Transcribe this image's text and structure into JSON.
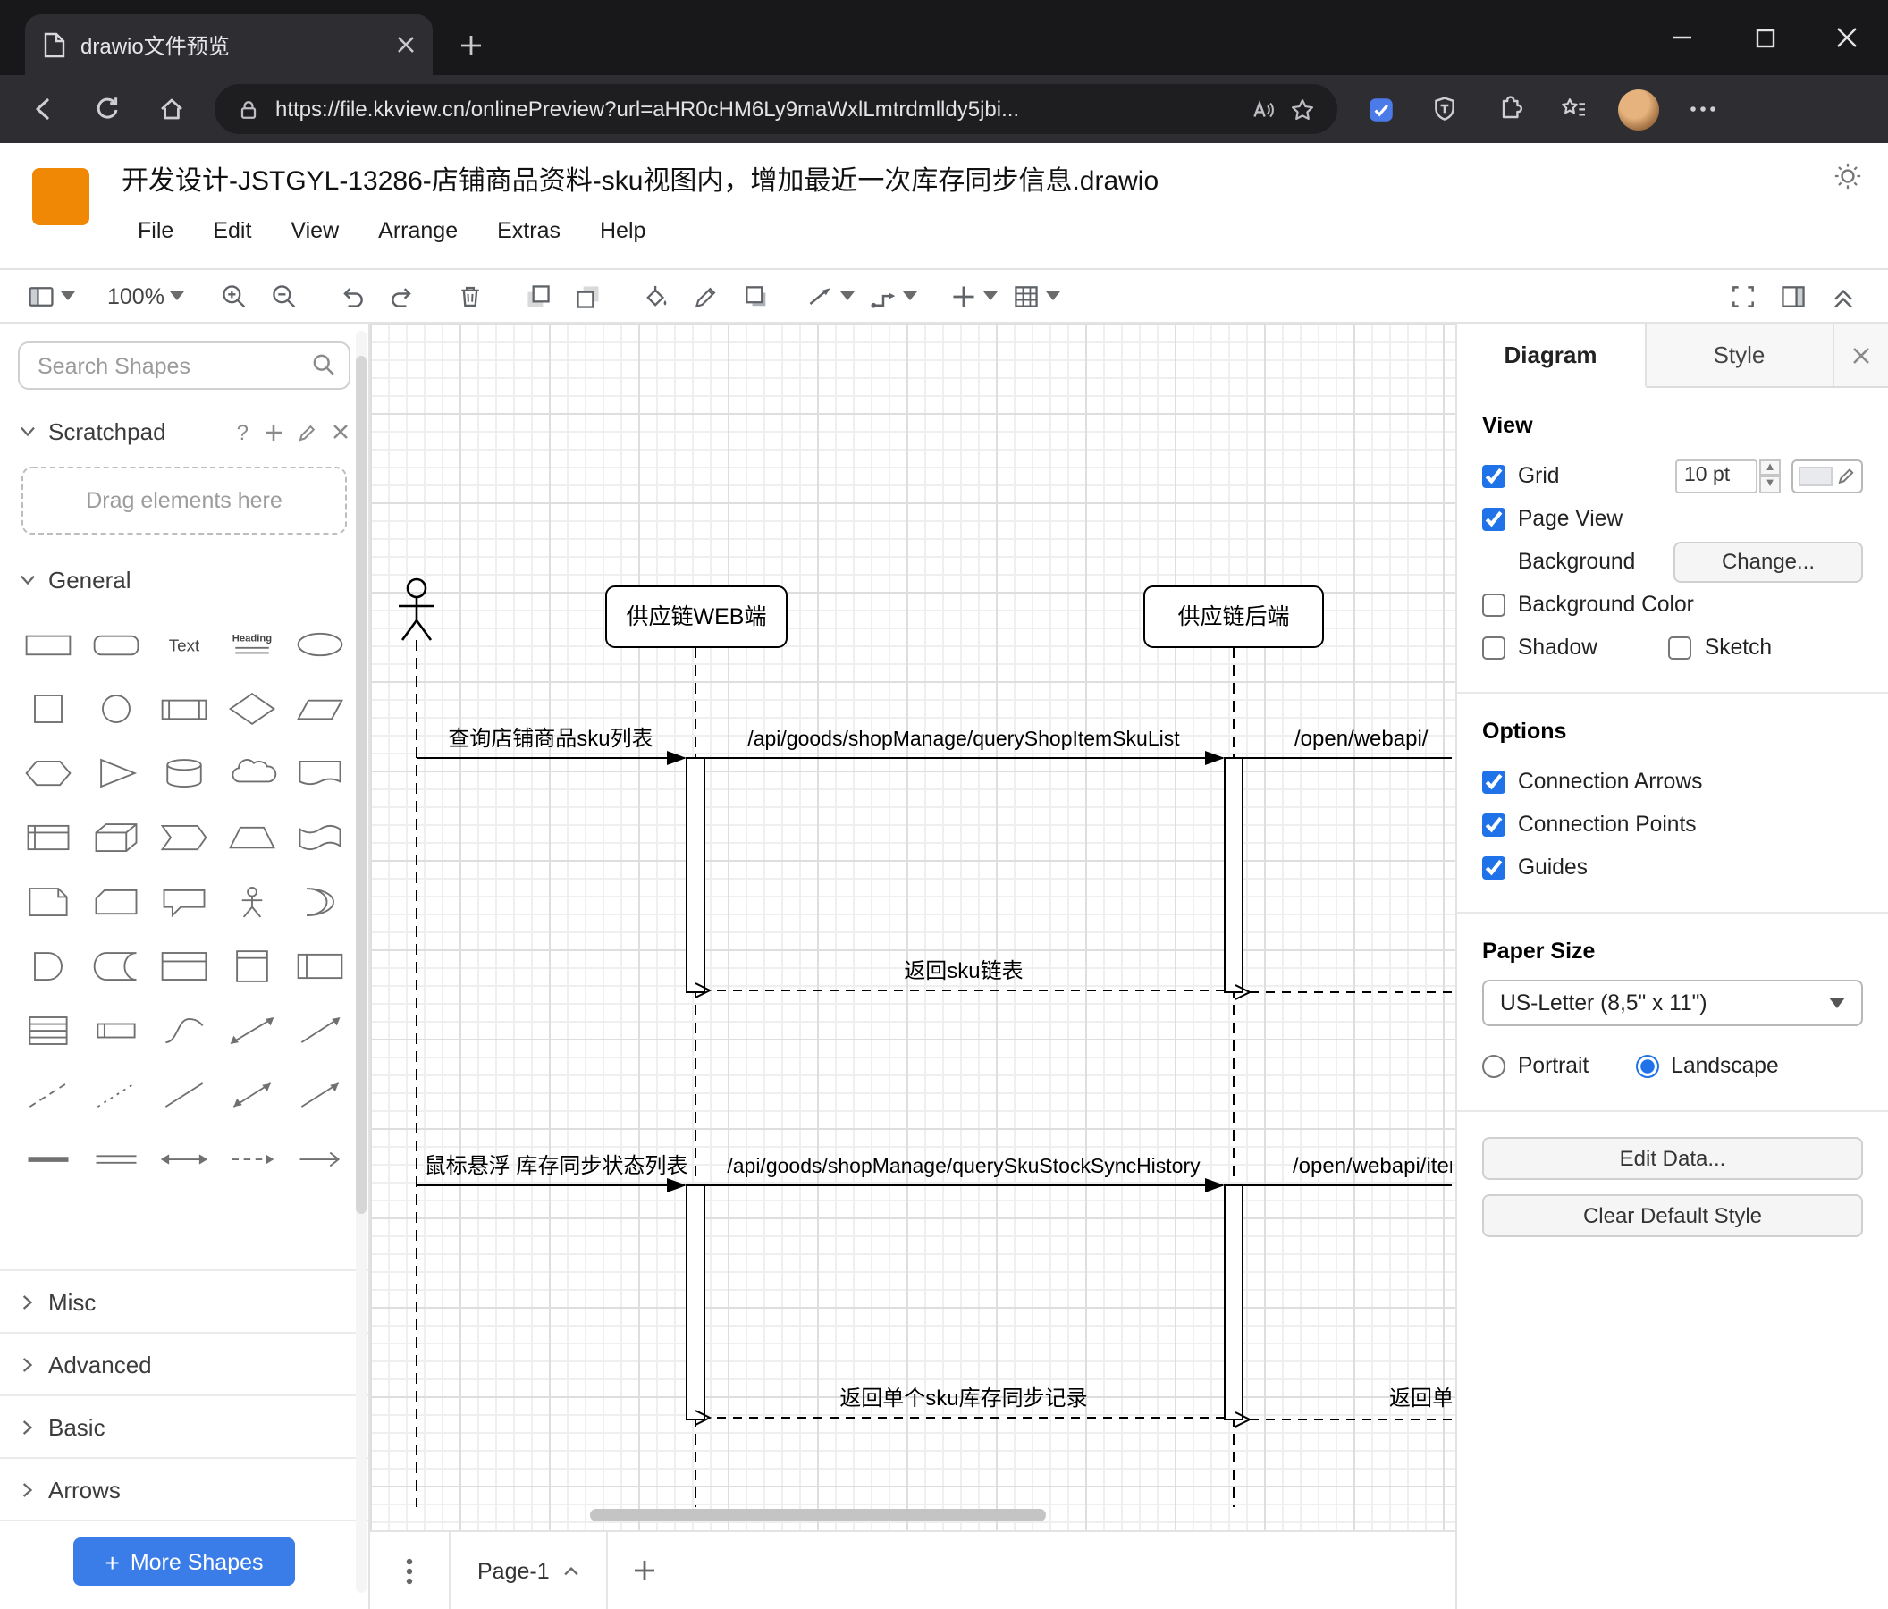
{
  "browser": {
    "tab_title": "drawio文件预览",
    "url": "https://file.kkview.cn/onlinePreview?url=aHR0cHM6Ly9maWxlLmtrdmlldy5jbi..."
  },
  "app": {
    "title": "开发设计-JSTGYL-13286-店铺商品资料-sku视图内，增加最近一次库存同步信息.drawio",
    "menus": [
      "File",
      "Edit",
      "View",
      "Arrange",
      "Extras",
      "Help"
    ],
    "zoom": "100%"
  },
  "sidebar": {
    "search_placeholder": "Search Shapes",
    "scratchpad_title": "Scratchpad",
    "help_glyph": "?",
    "drop_hint": "Drag elements here",
    "general_title": "General",
    "collapsed": [
      "Misc",
      "Advanced",
      "Basic",
      "Arrows"
    ],
    "more_shapes": "More Shapes",
    "shape_labels": {
      "text": "Text",
      "heading": "Heading",
      "list": "List"
    },
    "shapes": [
      "rectangle",
      "rounded-rectangle",
      "text",
      "heading",
      "ellipse",
      "square",
      "circle",
      "process",
      "diamond",
      "parallelogram",
      "hexagon",
      "triangle",
      "cylinder",
      "cloud",
      "document",
      "internal-storage",
      "cube",
      "step",
      "trapezoid",
      "tape",
      "note",
      "card",
      "callout",
      "actor",
      "or",
      "and",
      "data-storage",
      "container",
      "vertical-container",
      "horizontal-container",
      "list",
      "list-item",
      "curve",
      "bidirectional-arrow",
      "arrow",
      "dashed-line",
      "dotted-line",
      "line",
      "bidirectional-connector",
      "directional-connector",
      "bold-line",
      "link",
      "double-arrow",
      "dashed-arrow",
      "open-arrow"
    ]
  },
  "diagram": {
    "web_label": "供应链WEB端",
    "backend_label": "供应链后端",
    "msg_query": "查询店铺商品sku列表",
    "api_query_list": "/api/goods/shopManage/queryShopItemSkuList",
    "api_open1": "/open/webapi/",
    "ret_sku": "返回sku链表",
    "msg_hover": "鼠标悬浮 库存同步状态列表",
    "api_query_history": "/api/goods/shopManage/querySkuStockSyncHistory",
    "api_open2": "/open/webapi/item",
    "ret_single": "返回单个sku库存同步记录",
    "ret_right": "返回单个sku库存同步记录"
  },
  "canvas": {
    "page_name": "Page-1"
  },
  "format": {
    "tab_diagram": "Diagram",
    "tab_style": "Style",
    "view_heading": "View",
    "grid": "Grid",
    "grid_size": "10 pt",
    "page_view": "Page View",
    "background": "Background",
    "change": "Change...",
    "background_color": "Background Color",
    "shadow": "Shadow",
    "sketch": "Sketch",
    "options_heading": "Options",
    "connection_arrows": "Connection Arrows",
    "connection_points": "Connection Points",
    "guides": "Guides",
    "paper_heading": "Paper Size",
    "paper_size": "US-Letter (8,5\" x 11\")",
    "portrait": "Portrait",
    "landscape": "Landscape",
    "edit_data": "Edit Data...",
    "clear_default": "Clear Default Style"
  }
}
